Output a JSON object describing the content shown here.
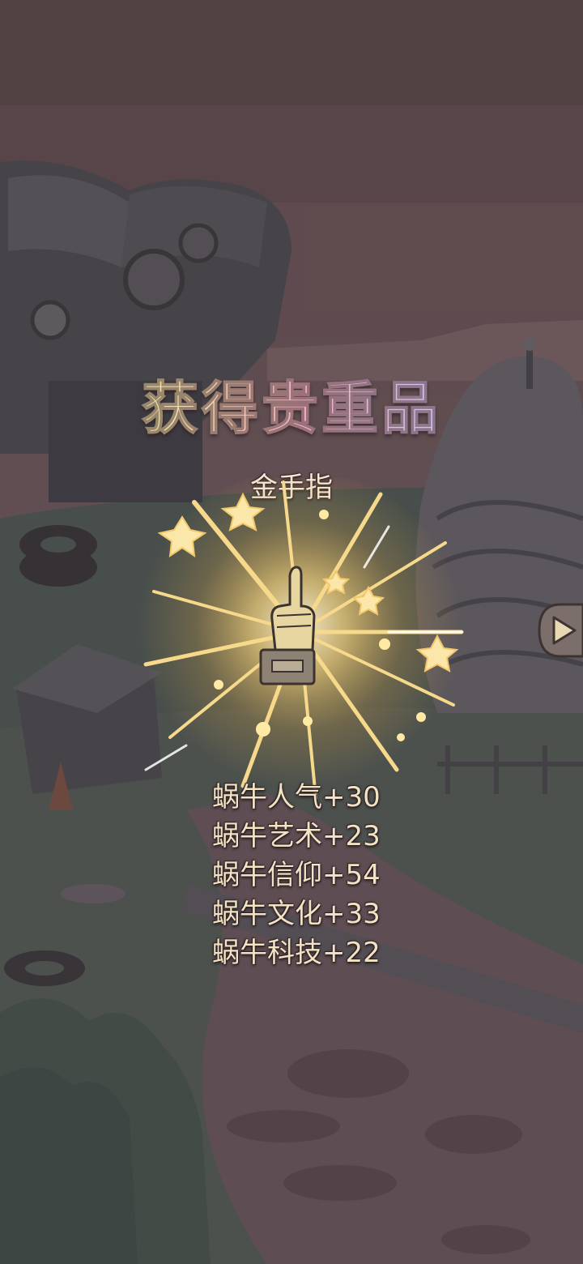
{
  "reward": {
    "title": "获得贵重品",
    "item_name": "金手指"
  },
  "stats": [
    {
      "text": "蜗牛人气+30"
    },
    {
      "text": "蜗牛艺术+23"
    },
    {
      "text": "蜗牛信仰+54"
    },
    {
      "text": "蜗牛文化+33"
    },
    {
      "text": "蜗牛科技+22"
    }
  ],
  "icons": {
    "item_icon": "golden-finger-trophy-icon",
    "next_icon": "play-arrow-icon"
  },
  "colors": {
    "stat_text": "#f2e3c4",
    "burst_gold": "#f6d27a",
    "title_gradient": [
      "#b7e6c8",
      "#f3e2a6",
      "#f6b3c7",
      "#cfc0f2",
      "#b8dff0"
    ]
  }
}
